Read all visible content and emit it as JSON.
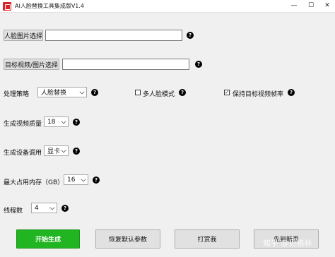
{
  "window": {
    "title": "AI人脸替换工具集成版V1.4",
    "controls": {
      "minimize": "—",
      "maximize": "☐",
      "close": "✕"
    },
    "accent_icon_color": "#d8242a"
  },
  "face_select": {
    "button_label": "人脸图片选择",
    "value": ""
  },
  "target_select": {
    "button_label": "目标视频/图片选择",
    "value": ""
  },
  "strategy": {
    "label": "处理策略",
    "selected": "人脸替换"
  },
  "multi_face": {
    "label": "多人脸模式",
    "checked": false
  },
  "keep_fps": {
    "label": "保持目标视频帧率",
    "checked": true
  },
  "quality": {
    "label": "生成视频质量",
    "selected": "18"
  },
  "device": {
    "label": "生成设备调用",
    "selected": "显卡"
  },
  "memory": {
    "label": "最大占用内存（GB）",
    "selected": "16"
  },
  "threads": {
    "label": "线程数",
    "selected": "4"
  },
  "actions": {
    "start": "开始生成",
    "reset": "恢复默认参数",
    "tip": "打赏我",
    "fourth": "先到新页"
  },
  "help_icon_glyph": "?",
  "watermark": "知乎 @贝格林"
}
